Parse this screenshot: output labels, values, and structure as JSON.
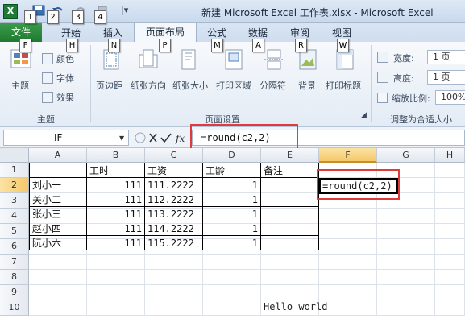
{
  "window": {
    "title": "新建 Microsoft Excel 工作表.xlsx - Microsoft Excel",
    "app_icon": "X"
  },
  "quick_access": {
    "keytips": [
      "1",
      "2",
      "3",
      "4"
    ]
  },
  "tabs": {
    "file": "文件",
    "items": [
      {
        "label": "开始",
        "keytip": "H"
      },
      {
        "label": "插入",
        "keytip": "N"
      },
      {
        "label": "页面布局",
        "keytip": "P"
      },
      {
        "label": "公式",
        "keytip": "M"
      },
      {
        "label": "数据",
        "keytip": "A"
      },
      {
        "label": "审阅",
        "keytip": "R"
      },
      {
        "label": "视图",
        "keytip": "W"
      }
    ],
    "file_keytip": "F",
    "active": "页面布局"
  },
  "ribbon": {
    "theme_group": {
      "label": "主题",
      "theme_button": "主题",
      "colors": "颜色",
      "fonts": "字体",
      "effects": "效果"
    },
    "page_setup_group": {
      "label": "页面设置",
      "margins": "页边距",
      "orientation": "纸张方向",
      "size": "纸张大小",
      "print_area": "打印区域",
      "breaks": "分隔符",
      "background": "背景",
      "print_titles": "打印标题"
    },
    "scale_group": {
      "label": "调整为合适大小",
      "width_label": "宽度:",
      "width_value": "1 页",
      "height_label": "高度:",
      "height_value": "1 页",
      "scale_label": "缩放比例:",
      "scale_value": "100%"
    }
  },
  "formula_bar": {
    "name_box": "IF",
    "formula": "=round(c2,2)"
  },
  "sheet": {
    "columns": [
      "A",
      "B",
      "C",
      "D",
      "E",
      "F",
      "G",
      "H"
    ],
    "selected_column": "F",
    "rows": [
      "1",
      "2",
      "3",
      "4",
      "5",
      "6",
      "7",
      "8",
      "9",
      "10"
    ],
    "selected_row": "2",
    "headers": {
      "B": "工时",
      "C": "工资",
      "D": "工龄",
      "E": "备注"
    },
    "data": [
      {
        "name": "刘小一",
        "hours": "111",
        "salary": "111.2222",
        "years": "1"
      },
      {
        "name": "关小二",
        "hours": "111",
        "salary": "112.2222",
        "years": "1"
      },
      {
        "name": "张小三",
        "hours": "111",
        "salary": "113.2222",
        "years": "1"
      },
      {
        "name": "赵小四",
        "hours": "111",
        "salary": "114.2222",
        "years": "1"
      },
      {
        "name": "阮小六",
        "hours": "111",
        "salary": "115.2222",
        "years": "1"
      }
    ],
    "active_cell_content": "=round(c2,2)",
    "hello_text": "Hello world"
  }
}
